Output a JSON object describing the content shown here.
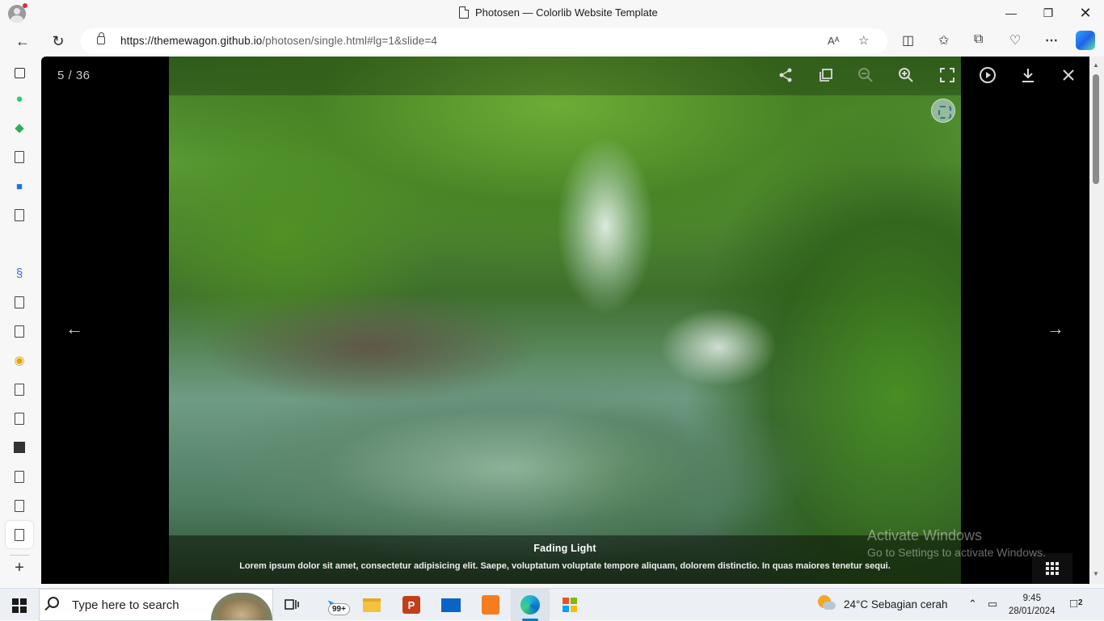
{
  "window": {
    "title": "Photosen — Colorlib Website Template"
  },
  "address": {
    "url_host": "https://themewagon.github.io",
    "url_path": "/photosen/single.html#lg=1&slide=4"
  },
  "lightbox": {
    "counter": "5 / 36",
    "caption_title": "Fading Light",
    "caption_text": "Lorem ipsum dolor sit amet, consectetur adipisicing elit. Saepe, voluptatum voluptate tempore aliquam, dolorem distinctio. In quas maiores tenetur sequi.",
    "tools": [
      "share-icon",
      "copy-icon",
      "zoom-out-icon",
      "zoom-in-icon",
      "fullscreen-icon",
      "play-icon",
      "download-icon",
      "close-icon"
    ]
  },
  "watermark": {
    "title": "Activate Windows",
    "subtitle": "Go to Settings to activate Windows."
  },
  "taskbar": {
    "search_placeholder": "Type here to search",
    "mail_badge": "99+",
    "weather": "24°C  Sebagian cerah",
    "time": "9:45",
    "date": "28/01/2024",
    "notifications": "2"
  }
}
